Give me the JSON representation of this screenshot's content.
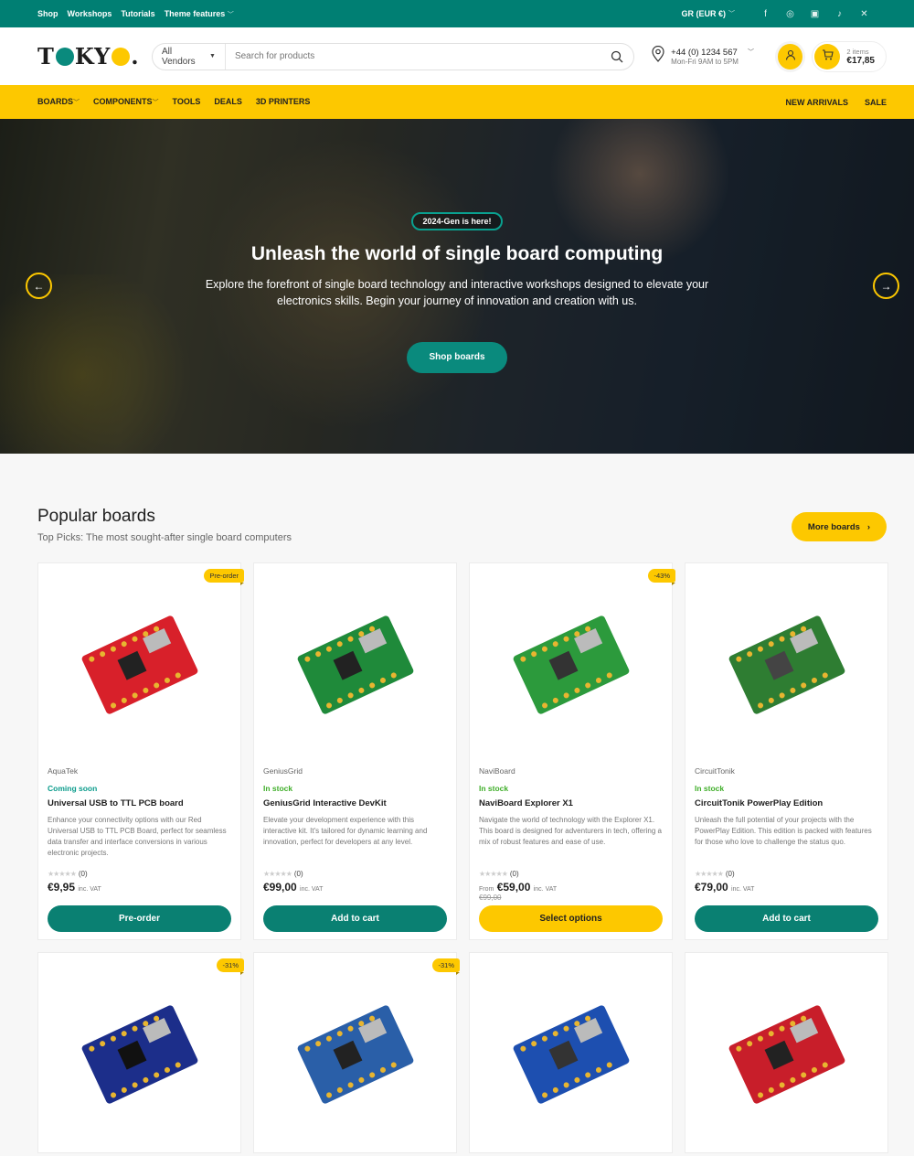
{
  "topbar": {
    "links": [
      "Shop",
      "Workshops",
      "Tutorials",
      "Theme features"
    ],
    "currency": "GR (EUR €)",
    "social": [
      "facebook-icon",
      "instagram-icon",
      "linkedin-icon",
      "tiktok-icon",
      "x-icon"
    ]
  },
  "header": {
    "logo": {
      "letters": [
        "T",
        "KY",
        "."
      ]
    },
    "search": {
      "vendor": "All Vendors",
      "placeholder": "Search for products"
    },
    "contact": {
      "phone": "+44 (0) 1234 567",
      "hours": "Mon-Fri 9AM to 5PM"
    },
    "cart": {
      "items": "2 items",
      "total": "€17,85"
    }
  },
  "nav": {
    "left": [
      "BOARDS",
      "COMPONENTS",
      "TOOLS",
      "DEALS",
      "3D PRINTERS"
    ],
    "right": [
      "NEW ARRIVALS",
      "SALE"
    ]
  },
  "hero": {
    "badge": "2024-Gen is here!",
    "title": "Unleash the world of single board computing",
    "text": "Explore the forefront of single board technology and interactive workshops designed to elevate your electronics skills. Begin your journey of innovation and creation with us.",
    "button": "Shop boards"
  },
  "section": {
    "title": "Popular boards",
    "subtitle": "Top Picks: The most sought-after single board computers",
    "more": "More boards"
  },
  "products": [
    {
      "tag": "Pre-order",
      "vendor": "AquaTek",
      "stock": "Coming soon",
      "name": "Universal USB to TTL PCB board",
      "desc": "Enhance your connectivity options with our Red Universal USB to TTL PCB Board, perfect for seamless data transfer and interface conversions in various electronic projects.",
      "reviews": "(0)",
      "from": "",
      "price": "€9,95",
      "vat": "inc. VAT",
      "old": "",
      "button": "Pre-order"
    },
    {
      "tag": "",
      "vendor": "GeniusGrid",
      "stock": "In stock",
      "name": "GeniusGrid Interactive DevKit",
      "desc": "Elevate your development experience with this interactive kit. It's tailored for dynamic learning and innovation, perfect for developers at any level.",
      "reviews": "(0)",
      "from": "",
      "price": "€99,00",
      "vat": "inc. VAT",
      "old": "",
      "button": "Add to cart"
    },
    {
      "tag": "-43%",
      "vendor": "NaviBoard",
      "stock": "In stock",
      "name": "NaviBoard Explorer X1",
      "desc": "Navigate the world of technology with the Explorer X1. This board is designed for adventurers in tech, offering a mix of robust features and ease of use.",
      "reviews": "(0)",
      "from": "From",
      "price": "€59,00",
      "vat": "inc. VAT",
      "old": "€99,00",
      "button": "Select options"
    },
    {
      "tag": "",
      "vendor": "CircuitTonik",
      "stock": "In stock",
      "name": "CircuitTonik PowerPlay Edition",
      "desc": "Unleash the full potential of your projects with the PowerPlay Edition. This edition is packed with features for those who love to challenge the status quo.",
      "reviews": "(0)",
      "from": "",
      "price": "€79,00",
      "vat": "inc. VAT",
      "old": "",
      "button": "Add to cart"
    }
  ],
  "products_row2": [
    {
      "tag": "-31%"
    },
    {
      "tag": "-31%"
    },
    {
      "tag": ""
    },
    {
      "tag": ""
    }
  ],
  "colors": {
    "teal": "#007f73",
    "yellow": "#fdc800",
    "stock_green": "#3fae29",
    "coming_soon": "#0a9b8b"
  }
}
